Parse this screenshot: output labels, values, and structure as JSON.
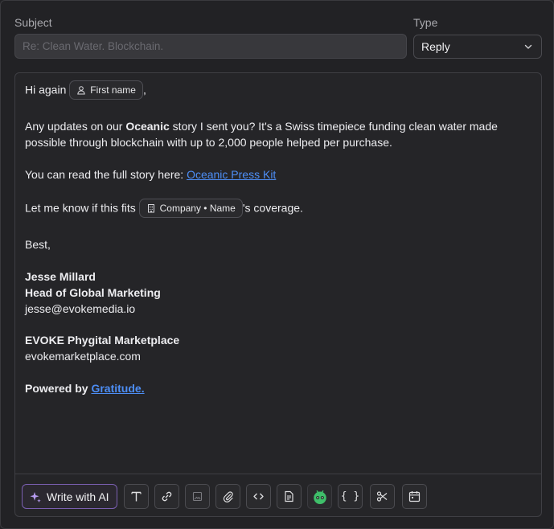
{
  "subject": {
    "label": "Subject",
    "placeholder": "Re: Clean Water. Blockchain."
  },
  "type": {
    "label": "Type",
    "selected": "Reply"
  },
  "email": {
    "greeting": "Hi again",
    "greeting_comma": ",",
    "first_name_chip": "First name",
    "p1_prefix": "Any updates on our ",
    "p1_bold": "Oceanic",
    "p1_suffix": " story I sent you? It's a Swiss timepiece funding clean water made",
    "p1_line2": "possible through blockchain with up to 2,000 people helped per purchase.",
    "p2_prefix": "You can read the full story here: ",
    "p2_link": "Oceanic Press Kit",
    "p3_prefix": "Let me know if this fits",
    "company_chip": "Company • Name",
    "p3_suffix": "'s coverage.",
    "closing": "Best,",
    "sig_name": "Jesse Millard",
    "sig_title": "Head of Global Marketing",
    "sig_email": "jesse@evokemedia.io",
    "company_name": "EVOKE Phygital Marketplace",
    "company_site": "evokemarketplace.com",
    "powered_prefix": "Powered by ",
    "powered_link": "Gratitude."
  },
  "toolbar": {
    "ai_label": "Write with AI",
    "tools": [
      "text-format-icon",
      "link-icon",
      "image-icon",
      "attachment-icon",
      "code-icon",
      "document-icon",
      "robot-icon",
      "variable-braces-icon",
      "scissors-icon",
      "calendar-icon"
    ]
  },
  "colors": {
    "accent_purple": "#7a5fb0",
    "link": "#4d8ef5",
    "robot_green": "#3fbf6a"
  }
}
